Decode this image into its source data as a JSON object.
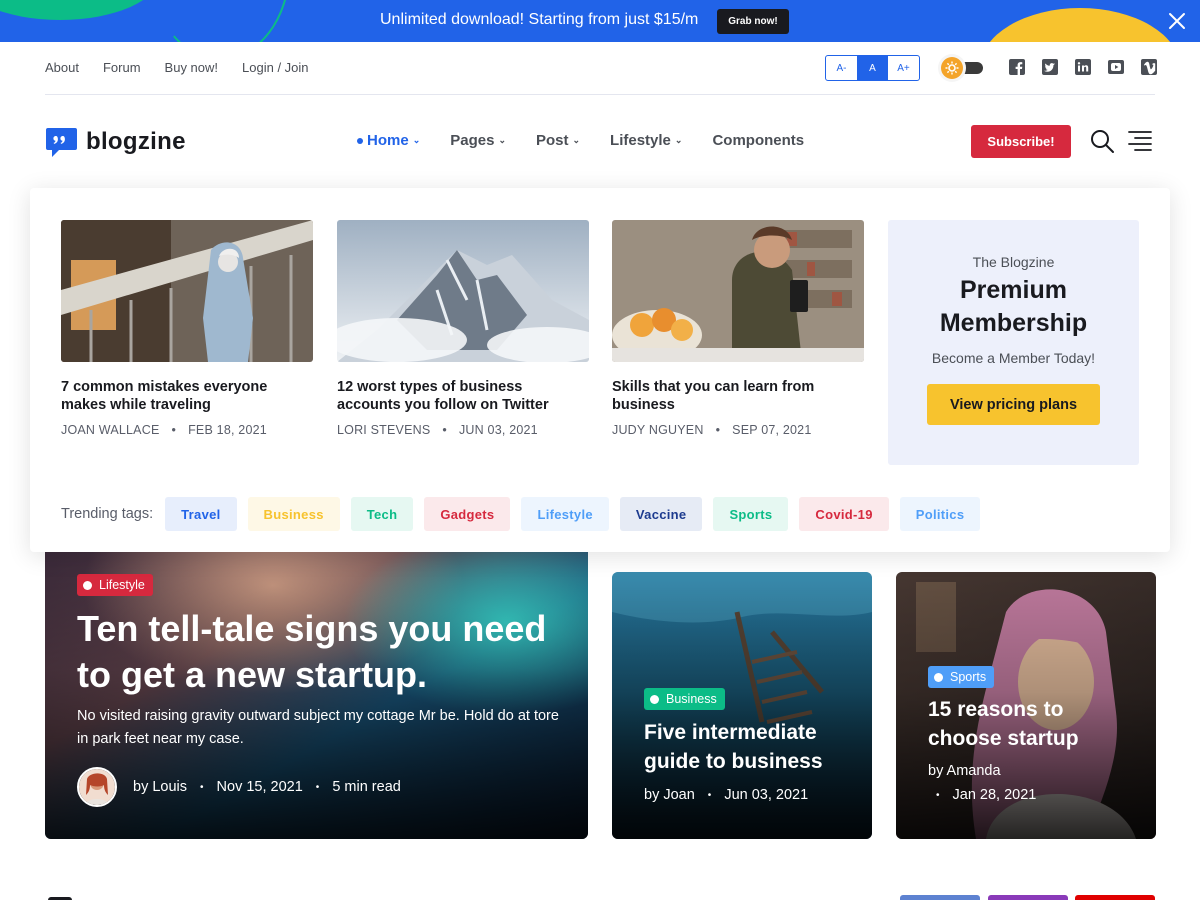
{
  "promo": {
    "text": "Unlimited download! Starting from just $15/m",
    "button": "Grab now!"
  },
  "topbar": {
    "links": [
      "About",
      "Forum",
      "Buy now!",
      "Login / Join"
    ],
    "font_sizes": [
      "A-",
      "A",
      "A+"
    ],
    "active_font_size": "A"
  },
  "socials": [
    "facebook-icon",
    "twitter-icon",
    "linkedin-icon",
    "youtube-icon",
    "vimeo-icon"
  ],
  "header": {
    "logo_text": "blogzine",
    "nav": [
      {
        "label": "Home",
        "active": true,
        "dropdown": true
      },
      {
        "label": "Pages",
        "active": false,
        "dropdown": true
      },
      {
        "label": "Post",
        "active": false,
        "dropdown": true
      },
      {
        "label": "Lifestyle",
        "active": false,
        "dropdown": true
      },
      {
        "label": "Components",
        "active": false,
        "dropdown": false
      }
    ],
    "subscribe": "Subscribe!"
  },
  "mega_menu": {
    "posts": [
      {
        "title": "7 common mistakes everyone makes while traveling",
        "author": "JOAN WALLACE",
        "date": "FEB 18, 2021"
      },
      {
        "title": "12 worst types of business accounts you follow on Twitter",
        "author": "LORI STEVENS",
        "date": "JUN 03, 2021"
      },
      {
        "title": "Skills that you can learn from business",
        "author": "JUDY NGUYEN",
        "date": "SEP 07, 2021"
      }
    ],
    "membership": {
      "pre": "The Blogzine",
      "title": "Premium Membership",
      "subtitle": "Become a Member Today!",
      "button": "View pricing plans"
    },
    "trending_label": "Trending tags:",
    "tags": [
      {
        "label": "Travel",
        "color": "#2163e8",
        "bg": "#e7eefc"
      },
      {
        "label": "Business",
        "color": "#f7c32e",
        "bg": "#fef8e6"
      },
      {
        "label": "Tech",
        "color": "#0cbc87",
        "bg": "#e6f8f2"
      },
      {
        "label": "Gadgets",
        "color": "#d6293e",
        "bg": "#fbe9eb"
      },
      {
        "label": "Lifestyle",
        "color": "#4f9ef8",
        "bg": "#edf5fe"
      },
      {
        "label": "Vaccine",
        "color": "#1d3b8f",
        "bg": "#e6ebf5"
      },
      {
        "label": "Sports",
        "color": "#0cbc87",
        "bg": "#e6f8f2"
      },
      {
        "label": "Covid-19",
        "color": "#d6293e",
        "bg": "#fbe9eb"
      },
      {
        "label": "Politics",
        "color": "#4f9ef8",
        "bg": "#edf5fe"
      }
    ]
  },
  "features": {
    "main": {
      "badge": "Lifestyle",
      "badge_color": "#d6293e",
      "title": "Ten tell-tale signs you need to get a new startup.",
      "desc": "No visited raising gravity outward subject my cottage Mr be. Hold do at tore in park feet near my case.",
      "author": "by Louis",
      "date": "Nov 15, 2021",
      "read": "5 min read"
    },
    "second": {
      "badge": "Business",
      "badge_color": "#0cbc87",
      "title": "Five intermediate guide to business",
      "author": "by Joan",
      "date": "Jun 03, 2021"
    },
    "third": {
      "badge": "Sports",
      "badge_color": "#4f9ef8",
      "title": "15 reasons to choose startup",
      "author": "by Amanda",
      "date": "Jan 28, 2021"
    }
  }
}
